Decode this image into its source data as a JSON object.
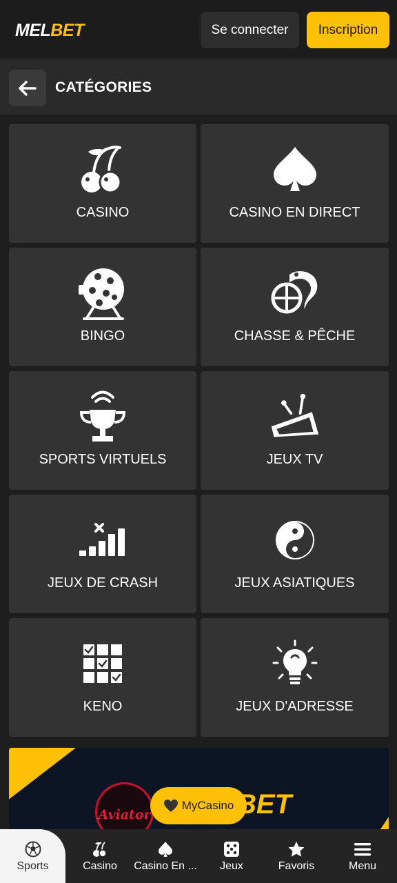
{
  "header": {
    "logo_part1": "MEL",
    "logo_part2": "BET",
    "login_label": "Se connecter",
    "register_label": "Inscription"
  },
  "subheader": {
    "title": "CATÉGORIES",
    "back_icon": "arrow-left-icon"
  },
  "categories": [
    {
      "label": "CASINO",
      "icon": "cherries-icon"
    },
    {
      "label": "CASINO EN DIRECT",
      "icon": "spade-icon"
    },
    {
      "label": "BINGO",
      "icon": "bingo-drum-icon"
    },
    {
      "label": "CHASSE & PÊCHE",
      "icon": "fish-crosshair-icon"
    },
    {
      "label": "SPORTS VIRTUELS",
      "icon": "trophy-signal-icon"
    },
    {
      "label": "JEUX TV",
      "icon": "tv-icon"
    },
    {
      "label": "JEUX DE CRASH",
      "icon": "crash-bars-icon"
    },
    {
      "label": "JEUX ASIATIQUES",
      "icon": "yin-yang-icon"
    },
    {
      "label": "KENO",
      "icon": "keno-grid-icon"
    },
    {
      "label": "JEUX D'ADRESSE",
      "icon": "lightbulb-icon"
    }
  ],
  "banner": {
    "brand_left": "Aviator",
    "brand_right": "BET"
  },
  "floating": {
    "label": "MyCasino",
    "icon": "heart-icon"
  },
  "bottom_nav": [
    {
      "label": "Sports",
      "icon": "soccer-ball-icon",
      "active": true
    },
    {
      "label": "Casino",
      "icon": "cherries-icon",
      "active": false
    },
    {
      "label": "Casino En ...",
      "icon": "spade-icon",
      "active": false
    },
    {
      "label": "Jeux",
      "icon": "dice-icon",
      "active": false
    },
    {
      "label": "Favoris",
      "icon": "star-icon",
      "active": false
    },
    {
      "label": "Menu",
      "icon": "hamburger-icon",
      "active": false
    }
  ],
  "colors": {
    "accent": "#ffc107",
    "background": "#1e1e1e",
    "tile": "#333333"
  }
}
